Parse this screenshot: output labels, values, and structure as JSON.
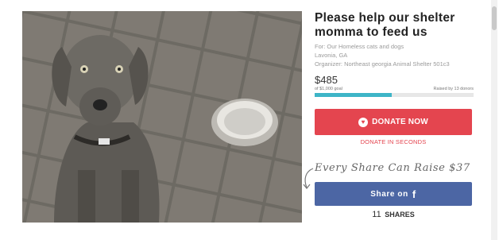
{
  "campaign": {
    "title_line1": "Please help our shelter",
    "title_line2": "momma to feed us",
    "for_line": "For: Our Homeless cats and dogs",
    "location": "Lavonia, GA",
    "organizer": "Organizer: Northeast georgia Animal Shelter 501c3"
  },
  "funding": {
    "raised": "$485",
    "goal": "of $1,000 goal",
    "donors": "Raised by 13 donors",
    "progress_fraction": 0.485
  },
  "actions": {
    "donate_label": "DONATE NOW",
    "donate_seconds": "DONATE IN SECONDS",
    "every_share": "Every Share Can Raise $37",
    "share_label": "Share on",
    "share_icon_glyph": "f",
    "shares_count": "11",
    "shares_label": "SHARES"
  },
  "colors": {
    "donate": "#e4454f",
    "facebook": "#4c66a4",
    "progress": "#3db5c7"
  },
  "icons": {
    "donate_icon": "heart-icon",
    "share_icon": "facebook-icon"
  }
}
